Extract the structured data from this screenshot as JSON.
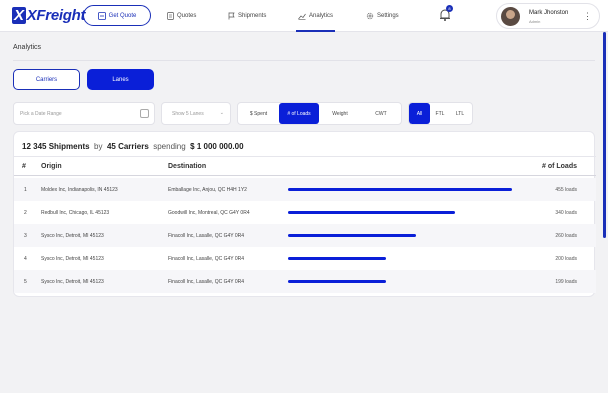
{
  "app": {
    "logo": "XFreight"
  },
  "header": {
    "get_quote": "Get Quote",
    "nav": [
      {
        "label": "Quotes",
        "icon": "document-icon"
      },
      {
        "label": "Shipments",
        "icon": "flag-icon"
      },
      {
        "label": "Analytics",
        "icon": "chart-icon",
        "active": true
      },
      {
        "label": "Settings",
        "icon": "gear-icon"
      }
    ],
    "notifications": "8",
    "user": {
      "name": "Mark Jhonston",
      "role": "Admin"
    }
  },
  "page": {
    "title": "Analytics",
    "tabs": [
      {
        "label": "Carriers"
      },
      {
        "label": "Lanes",
        "active": true
      }
    ],
    "filters": {
      "date_placeholder": "Pick a Date Range",
      "select_value": "Show 5 Lanes",
      "metric_options": [
        "$ Spent",
        "# of Loads",
        "Weight",
        "CWT"
      ],
      "metric_selected": "# of Loads",
      "mode_options": [
        "All",
        "FTL",
        "LTL"
      ],
      "mode_selected": "All"
    }
  },
  "summary": {
    "shipments": "12 345 Shipments",
    "by": "by",
    "carriers": "45 Carriers",
    "spending": "spending",
    "amount": "$ 1 000 000.00"
  },
  "table": {
    "columns": {
      "num": "#",
      "origin": "Origin",
      "destination": "Destination",
      "loads": "# of Loads"
    },
    "rows": [
      {
        "num": "1",
        "origin": "Moldex Inc, Indianapolis, IN 45123",
        "destination": "Emballage Inc, Anjou, QC H4H 1Y2",
        "loads_value": 455,
        "loads": "455 loads"
      },
      {
        "num": "2",
        "origin": "Redbull Inc, Chicago, IL 45123",
        "destination": "Goodwill Inc, Montreal, QC G4Y 0R4",
        "loads_value": 340,
        "loads": "340 loads"
      },
      {
        "num": "3",
        "origin": "Sysco Inc, Detroit, MI 45123",
        "destination": "Finacoll Inc, Lasalle, QC G4Y 0R4",
        "loads_value": 260,
        "loads": "260 loads"
      },
      {
        "num": "4",
        "origin": "Sysco Inc, Detroit, MI 45123",
        "destination": "Finacoll Inc, Lasalle, QC G4Y 0R4",
        "loads_value": 200,
        "loads": "200 loads"
      },
      {
        "num": "5",
        "origin": "Sysco Inc, Detroit, MI 45123",
        "destination": "Finacoll Inc, Lasalle, QC G4Y 0R4",
        "loads_value": 199,
        "loads": "199 loads"
      }
    ]
  },
  "colors": {
    "accent": "#0a1fd8",
    "brand": "#1a2fb8"
  }
}
